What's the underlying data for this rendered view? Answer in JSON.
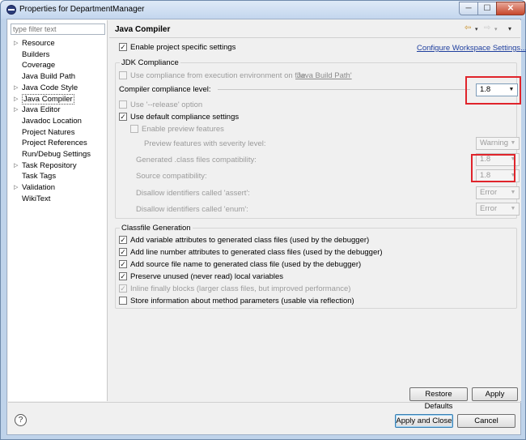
{
  "window": {
    "title": "Properties for DepartmentManager",
    "minimize": "─",
    "maximize": "☐",
    "close": "✕"
  },
  "sidebar": {
    "filter_placeholder": "type filter text",
    "items": [
      {
        "label": "Resource",
        "expandable": true
      },
      {
        "label": "Builders",
        "expandable": false
      },
      {
        "label": "Coverage",
        "expandable": false
      },
      {
        "label": "Java Build Path",
        "expandable": false
      },
      {
        "label": "Java Code Style",
        "expandable": true
      },
      {
        "label": "Java Compiler",
        "expandable": true,
        "selected": true
      },
      {
        "label": "Java Editor",
        "expandable": true
      },
      {
        "label": "Javadoc Location",
        "expandable": false
      },
      {
        "label": "Project Natures",
        "expandable": false
      },
      {
        "label": "Project References",
        "expandable": false
      },
      {
        "label": "Run/Debug Settings",
        "expandable": false
      },
      {
        "label": "Task Repository",
        "expandable": true
      },
      {
        "label": "Task Tags",
        "expandable": false
      },
      {
        "label": "Validation",
        "expandable": true
      },
      {
        "label": "WikiText",
        "expandable": false
      }
    ]
  },
  "page": {
    "title": "Java Compiler",
    "enable_project_specific": "Enable project specific settings",
    "configure_workspace_link": "Configure Workspace Settings...",
    "nav_icons": [
      "back-arrow-icon",
      "dropdown-icon",
      "forward-arrow-icon",
      "dropdown-icon",
      "view-menu-icon"
    ]
  },
  "jdk": {
    "group_title": "JDK Compliance",
    "use_compliance_prefix": "Use compliance from execution environment on the ",
    "use_compliance_link": "'Java Build Path'",
    "compliance_level_label": "Compiler compliance level:",
    "compliance_level_value": "1.8",
    "use_release": "Use '--release' option",
    "use_default_compliance": "Use default compliance settings",
    "enable_preview": "Enable preview features",
    "preview_severity_label": "Preview features with severity level:",
    "preview_severity_value": "Warning",
    "generated_class_label": "Generated .class files compatibility:",
    "generated_class_value": "1.8",
    "source_compat_label": "Source compatibility:",
    "source_compat_value": "1.8",
    "disallow_assert_label": "Disallow identifiers called 'assert':",
    "disallow_assert_value": "Error",
    "disallow_enum_label": "Disallow identifiers called 'enum':",
    "disallow_enum_value": "Error"
  },
  "classfile": {
    "group_title": "Classfile Generation",
    "options": [
      {
        "label": "Add variable attributes to generated class files (used by the debugger)",
        "checked": true,
        "enabled": true
      },
      {
        "label": "Add line number attributes to generated class files (used by the debugger)",
        "checked": true,
        "enabled": true
      },
      {
        "label": "Add source file name to generated class file (used by the debugger)",
        "checked": true,
        "enabled": true
      },
      {
        "label": "Preserve unused (never read) local variables",
        "checked": true,
        "enabled": true
      },
      {
        "label": "Inline finally blocks (larger class files, but improved performance)",
        "checked": true,
        "enabled": false
      },
      {
        "label": "Store information about method parameters (usable via reflection)",
        "checked": false,
        "enabled": true
      }
    ]
  },
  "buttons": {
    "restore_defaults": "Restore Defaults",
    "apply": "Apply",
    "apply_and_close": "Apply and Close",
    "cancel": "Cancel",
    "help": "?"
  },
  "colors": {
    "highlight_box": "#e0242b",
    "link": "#1f3f9e"
  }
}
